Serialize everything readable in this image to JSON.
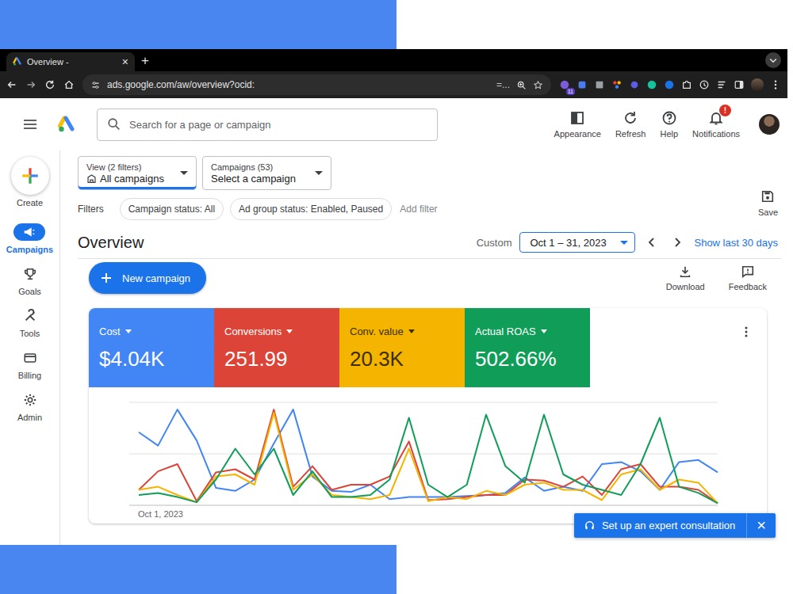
{
  "browser": {
    "tabs": [
      {
        "label": "Overview -",
        "selected": true
      }
    ],
    "close": "×",
    "new_tab": "+",
    "url": "ads.google.com/aw/overview?ocid:",
    "url_tail": "=...",
    "extension_badge": "11"
  },
  "header": {
    "search_placeholder": "Search for a page or campaign",
    "actions": [
      {
        "label": "Appearance",
        "kind": "appearance",
        "badge": ""
      },
      {
        "label": "Refresh",
        "kind": "refresh",
        "badge": ""
      },
      {
        "label": "Help",
        "kind": "help",
        "badge": ""
      },
      {
        "label": "Notifications",
        "kind": "bell",
        "badge": "!"
      }
    ]
  },
  "nav": {
    "create": "Create",
    "items": [
      {
        "label": "Campaigns",
        "kind": "campaigns",
        "selected": true
      },
      {
        "label": "Goals",
        "kind": "goals",
        "selected": false
      },
      {
        "label": "Tools",
        "kind": "tools",
        "selected": false
      },
      {
        "label": "Billing",
        "kind": "billing",
        "selected": false
      },
      {
        "label": "Admin",
        "kind": "admin",
        "selected": false
      }
    ]
  },
  "pickers": [
    {
      "label": "View (2 filters)",
      "value": "All campaigns",
      "kind": "view",
      "selected": true
    },
    {
      "label": "Campaigns (53)",
      "value": "Select a campaign",
      "kind": "campaign",
      "selected": false
    }
  ],
  "filters": {
    "label": "Filters",
    "chips": [
      "Campaign status: All",
      "Ad group status: Enabled, Paused"
    ],
    "add": "Add filter"
  },
  "save": "Save",
  "overview": {
    "title": "Overview",
    "range_label": "Custom",
    "range": "Oct 1 – 31, 2023",
    "show_last": "Show last 30 days"
  },
  "new_campaign": "New campaign",
  "tools": [
    {
      "label": "Download",
      "kind": "download"
    },
    {
      "label": "Feedback",
      "kind": "feedback"
    }
  ],
  "metrics": [
    {
      "label": "Cost",
      "value": "$4.04K",
      "color": "#4285f4",
      "series": [
        71,
        58,
        93,
        63,
        17,
        14,
        25,
        60,
        93,
        28,
        14,
        13,
        20,
        6,
        8,
        8,
        8,
        9,
        10,
        12,
        27,
        14,
        18,
        14,
        40,
        42,
        33,
        15,
        42,
        44,
        32
      ]
    },
    {
      "label": "Conversions",
      "value": "251.99",
      "color": "#db4437",
      "series": [
        15,
        33,
        40,
        4,
        32,
        35,
        25,
        93,
        18,
        38,
        15,
        20,
        20,
        28,
        62,
        5,
        6,
        8,
        10,
        10,
        25,
        24,
        18,
        28,
        10,
        35,
        40,
        18,
        18,
        15,
        2
      ]
    },
    {
      "label": "Conv. value",
      "value": "20.3K",
      "color": "#f4b400",
      "series": [
        15,
        18,
        10,
        3,
        28,
        30,
        20,
        90,
        15,
        30,
        10,
        8,
        6,
        10,
        55,
        4,
        8,
        6,
        14,
        10,
        20,
        22,
        15,
        15,
        5,
        30,
        35,
        15,
        25,
        22,
        2
      ]
    },
    {
      "label": "Actual ROAS",
      "value": "502.66%",
      "color": "#0f9d58",
      "series": [
        10,
        12,
        8,
        3,
        25,
        55,
        30,
        55,
        10,
        33,
        8,
        8,
        10,
        25,
        85,
        20,
        8,
        20,
        88,
        38,
        22,
        88,
        30,
        20,
        15,
        10,
        40,
        85,
        18,
        12,
        2
      ]
    }
  ],
  "chart": {
    "x_start": "Oct 1, 2023"
  },
  "consultation": {
    "label": "Set up an expert consultation",
    "close": "×"
  }
}
